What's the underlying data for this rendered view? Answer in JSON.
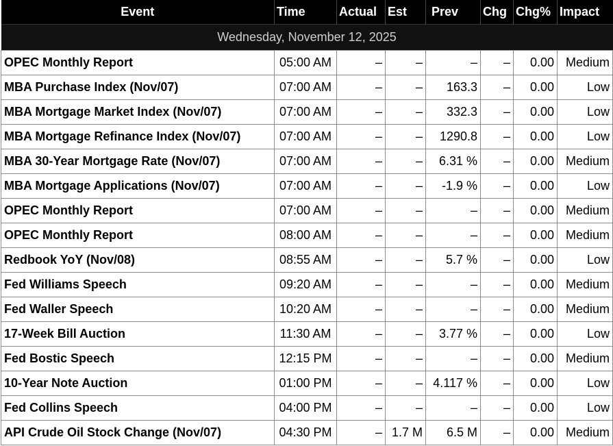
{
  "headers": {
    "event": "Event",
    "time": "Time",
    "actual": "Actual",
    "est": "Est",
    "prev": "Prev",
    "chg": "Chg",
    "chg_pct": "Chg%",
    "impact": "Impact"
  },
  "date_label": "Wednesday, November 12, 2025",
  "rows": [
    {
      "event": "OPEC Monthly Report",
      "time": "05:00 AM",
      "actual": "–",
      "est": "–",
      "prev": "–",
      "chg": "–",
      "chg_pct": "0.00",
      "impact": "Medium"
    },
    {
      "event": "MBA Purchase Index (Nov/07)",
      "time": "07:00 AM",
      "actual": "–",
      "est": "–",
      "prev": "163.3",
      "chg": "–",
      "chg_pct": "0.00",
      "impact": "Low"
    },
    {
      "event": "MBA Mortgage Market Index (Nov/07)",
      "time": "07:00 AM",
      "actual": "–",
      "est": "–",
      "prev": "332.3",
      "chg": "–",
      "chg_pct": "0.00",
      "impact": "Low"
    },
    {
      "event": "MBA Mortgage Refinance Index (Nov/07)",
      "time": "07:00 AM",
      "actual": "–",
      "est": "–",
      "prev": "1290.8",
      "chg": "–",
      "chg_pct": "0.00",
      "impact": "Low"
    },
    {
      "event": "MBA 30-Year Mortgage Rate (Nov/07)",
      "time": "07:00 AM",
      "actual": "–",
      "est": "–",
      "prev": "6.31 %",
      "chg": "–",
      "chg_pct": "0.00",
      "impact": "Medium"
    },
    {
      "event": "MBA Mortgage Applications (Nov/07)",
      "time": "07:00 AM",
      "actual": "–",
      "est": "–",
      "prev": "-1.9 %",
      "chg": "–",
      "chg_pct": "0.00",
      "impact": "Low"
    },
    {
      "event": "OPEC Monthly Report",
      "time": "07:00 AM",
      "actual": "–",
      "est": "–",
      "prev": "–",
      "chg": "–",
      "chg_pct": "0.00",
      "impact": "Medium"
    },
    {
      "event": "OPEC Monthly Report",
      "time": "08:00 AM",
      "actual": "–",
      "est": "–",
      "prev": "–",
      "chg": "–",
      "chg_pct": "0.00",
      "impact": "Medium"
    },
    {
      "event": "Redbook YoY (Nov/08)",
      "time": "08:55 AM",
      "actual": "–",
      "est": "–",
      "prev": "5.7 %",
      "chg": "–",
      "chg_pct": "0.00",
      "impact": "Low"
    },
    {
      "event": "Fed Williams Speech",
      "time": "09:20 AM",
      "actual": "–",
      "est": "–",
      "prev": "–",
      "chg": "–",
      "chg_pct": "0.00",
      "impact": "Medium"
    },
    {
      "event": "Fed Waller Speech",
      "time": "10:20 AM",
      "actual": "–",
      "est": "–",
      "prev": "–",
      "chg": "–",
      "chg_pct": "0.00",
      "impact": "Medium"
    },
    {
      "event": "17-Week Bill Auction",
      "time": "11:30 AM",
      "actual": "–",
      "est": "–",
      "prev": "3.77 %",
      "chg": "–",
      "chg_pct": "0.00",
      "impact": "Low"
    },
    {
      "event": "Fed Bostic Speech",
      "time": "12:15 PM",
      "actual": "–",
      "est": "–",
      "prev": "–",
      "chg": "–",
      "chg_pct": "0.00",
      "impact": "Medium"
    },
    {
      "event": "10-Year Note Auction",
      "time": "01:00 PM",
      "actual": "–",
      "est": "–",
      "prev": "4.117 %",
      "chg": "–",
      "chg_pct": "0.00",
      "impact": "Low"
    },
    {
      "event": "Fed Collins Speech",
      "time": "04:00 PM",
      "actual": "–",
      "est": "–",
      "prev": "–",
      "chg": "–",
      "chg_pct": "0.00",
      "impact": "Low"
    },
    {
      "event": "API Crude Oil Stock Change (Nov/07)",
      "time": "04:30 PM",
      "actual": "–",
      "est": "1.7 M",
      "prev": "6.5 M",
      "chg": "–",
      "chg_pct": "0.00",
      "impact": "Medium"
    }
  ]
}
